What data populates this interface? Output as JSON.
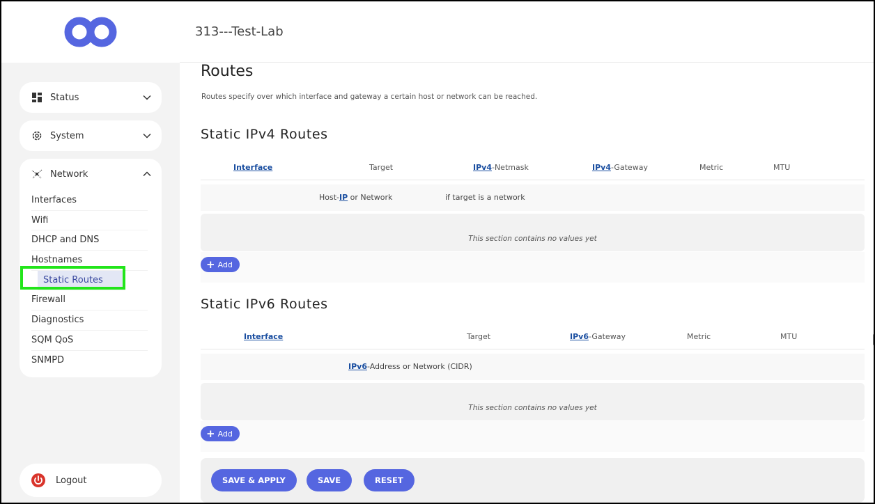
{
  "header": {
    "host": "313---Test-Lab"
  },
  "sidebar": {
    "menus": [
      {
        "label": "Status",
        "icon": "dashboard-icon"
      },
      {
        "label": "System",
        "icon": "gear-icon"
      },
      {
        "label": "Network",
        "icon": "network-icon"
      }
    ],
    "network_items": [
      "Interfaces",
      "Wifi",
      "DHCP and DNS",
      "Hostnames",
      "Static Routes",
      "Firewall",
      "Diagnostics",
      "SQM QoS",
      "SNMPD"
    ],
    "active_item": "Static Routes",
    "logout_label": "Logout"
  },
  "page": {
    "title": "Routes",
    "description": "Routes specify over which interface and gateway a certain host or network can be reached."
  },
  "ipv4": {
    "title": "Static IPv4 Routes",
    "columns": {
      "interface": "Interface",
      "target": "Target",
      "netmask_abbr": "IPv4",
      "netmask_rest": "-Netmask",
      "gateway_abbr": "IPv4",
      "gateway_rest": "-Gateway",
      "metric": "Metric",
      "mtu": "MTU"
    },
    "desc_target_pre": "Host-",
    "desc_target_abbr": "IP",
    "desc_target_post": " or Network",
    "desc_netmask": "if target is a network",
    "empty_text": "This section contains no values yet",
    "add_label": "Add"
  },
  "ipv6": {
    "title": "Static IPv6 Routes",
    "columns": {
      "interface": "Interface",
      "target": "Target",
      "gateway_abbr": "IPv6",
      "gateway_rest": "-Gateway",
      "metric": "Metric",
      "mtu": "MTU"
    },
    "desc_target_abbr": "IPv6",
    "desc_target_post": "-Address or Network (CIDR)",
    "empty_text": "This section contains no values yet",
    "add_label": "Add"
  },
  "actions": {
    "save_apply": "SAVE & APPLY",
    "save": "SAVE",
    "reset": "RESET"
  },
  "colors": {
    "accent": "#5566e0",
    "highlight": "#22e51a",
    "logout": "#d9342b"
  }
}
